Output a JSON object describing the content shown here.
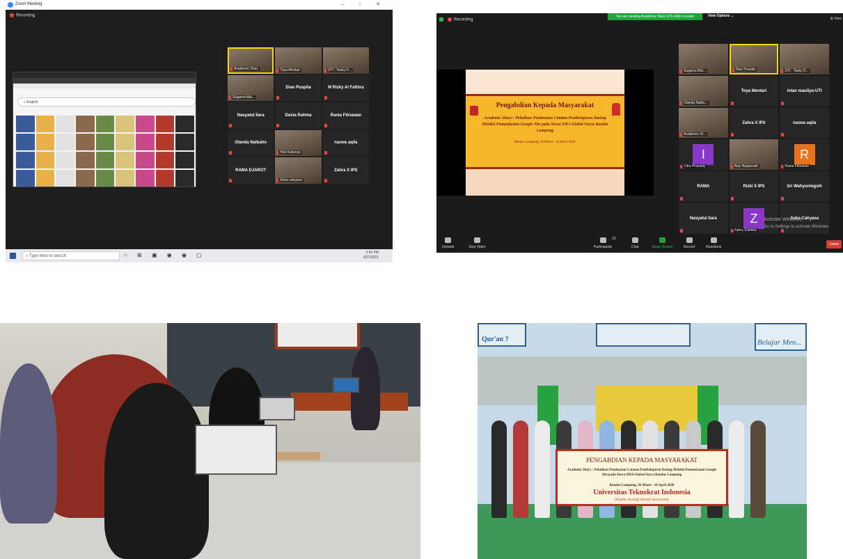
{
  "zoom_desktop": {
    "window_title": "Zoom Meeting",
    "recording_label": "Recording",
    "browser_search": "English",
    "participants": [
      {
        "name": "Academic Diary",
        "video": true,
        "active": true
      },
      {
        "name": "Toya Mentari",
        "video": true
      },
      {
        "name": "UTI - Tasky D...",
        "video": true
      },
      {
        "name": "Sugama Mai...",
        "video": true
      },
      {
        "name": "Dian Puspita"
      },
      {
        "name": "M Rizky Al Fathira"
      },
      {
        "name": "Nasyatul Iiara"
      },
      {
        "name": "Desta Rahma"
      },
      {
        "name": "Rania Fitriawan"
      },
      {
        "name": "Olanda Naibaho"
      },
      {
        "name": "Heri Kalwoya",
        "video": true
      },
      {
        "name": "nazwa aqila"
      },
      {
        "name": "RAMA DJAROT"
      },
      {
        "name": "Acha cahyasa",
        "video": true
      },
      {
        "name": "Zahra X IPS"
      }
    ],
    "taskbar": {
      "search_placeholder": "Type here to search",
      "time": "2:41 PM",
      "date": "3/27/2021"
    }
  },
  "zoom_meeting": {
    "recording_label": "Recording",
    "share_banner": "You are viewing Academic Diary UTI-UAS's screen",
    "view_options": "View Options",
    "view_button": "View",
    "slide": {
      "title": "Pengabdian Kepada Masyarakat",
      "subtitle": "Academic Diary : Pelatihan Pembuatan Catatan Pembelajaran Daring Melalui Pemanfaatan Google Site pada Siswa SMA Global Surya Bandar Lampung",
      "date": "Bandar Lampung, 26 Maret - 10 April 2020."
    },
    "participants": [
      {
        "name": "Sugama Mai...",
        "video": true
      },
      {
        "name": "Dian Puspita",
        "video": true,
        "active": true
      },
      {
        "name": "UTI - Tasky D...",
        "video": true
      },
      {
        "name": "Olanda Naibo...",
        "video": true
      },
      {
        "name": "Toya Mentari"
      },
      {
        "name": "intan mauliya-UTI"
      },
      {
        "name": "Academic Di...",
        "video": true
      },
      {
        "name": "Zahra X IPS"
      },
      {
        "name": "nazwa aqila"
      },
      {
        "name": "Citra Prasasty",
        "letter": "I",
        "letter_color": "#8a36c9"
      },
      {
        "name": "Aisy Nurjannah",
        "video": true
      },
      {
        "name": "Rania Fitriawan",
        "letter": "R",
        "letter_color": "#e8731a"
      },
      {
        "name": "RAMA"
      },
      {
        "name": "Rizki X IPS"
      },
      {
        "name": "Sri Wahyuningsih"
      },
      {
        "name": "Nasyatul Iiara"
      },
      {
        "name": "Zahra Zulekha",
        "letter": "Z",
        "letter_color": "#8a36c9"
      },
      {
        "name": "Acha Cahyasa"
      }
    ],
    "activate_windows": "Activate Windows",
    "activate_hint": "Go to Settings to activate Windows.",
    "toolbar": {
      "unmute": "Unmute",
      "stop_video": "Stop Video",
      "participants": "Participants",
      "participants_count": "23",
      "chat": "Chat",
      "share_screen": "Share Screen",
      "record": "Record",
      "reactions": "Reactions",
      "leave": "Leave"
    }
  },
  "photo_banner": {
    "title": "PENGABDIAN KEPADA MASYARAKAT",
    "subtitle": "Academic Diary : Pelatihan Pembuatan Catatan Pembelajaran Daring Melalui Pemanfaatan Google Site pada Siswa SMA Global Surya Bandar Lampung",
    "date": "Bandar Lampung, 26 Maret - 10 April 2020",
    "university": "Universitas Teknokrat Indonesia",
    "tagline": "Disiplin, Inovatif, Kreatif, dan Inventif",
    "wall_text_left": "Qur'an ?",
    "wall_text_right": "Belajar Men..."
  }
}
